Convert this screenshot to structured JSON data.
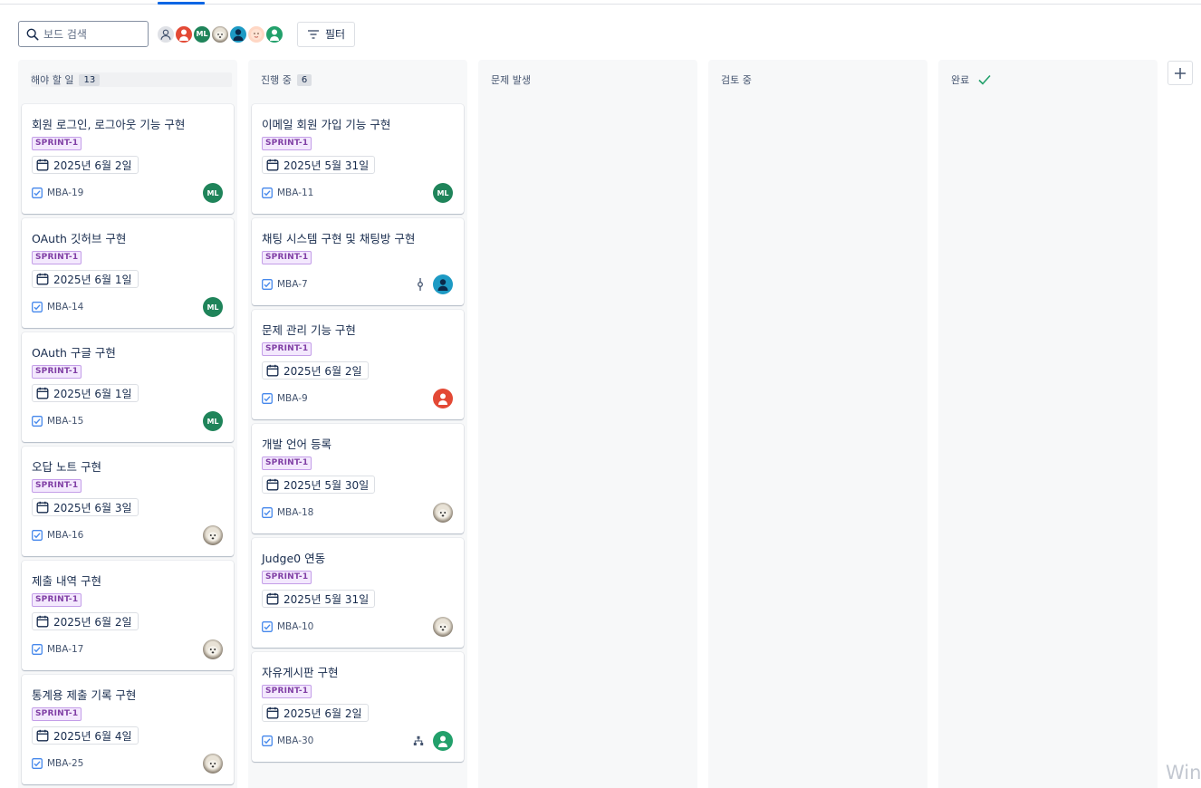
{
  "search": {
    "placeholder": "보드 검색"
  },
  "filter": {
    "label": "필터"
  },
  "avatar_initials": "ML",
  "columns": [
    {
      "title": "해야 할 일",
      "count": "13",
      "cards": [
        {
          "title": "회원 로그인, 로그아웃 기능 구현",
          "label": "SPRINT-1",
          "date": "2025년 6월 2일",
          "key": "MBA-19",
          "assignee": "ML"
        },
        {
          "title": "OAuth 깃허브 구현",
          "label": "SPRINT-1",
          "date": "2025년 6월 1일",
          "key": "MBA-14",
          "assignee": "ML"
        },
        {
          "title": "OAuth 구글 구현",
          "label": "SPRINT-1",
          "date": "2025년 6월 1일",
          "key": "MBA-15",
          "assignee": "ML"
        },
        {
          "title": "오답 노트 구현",
          "label": "SPRINT-1",
          "date": "2025년 6월 3일",
          "key": "MBA-16",
          "assignee": "dog"
        },
        {
          "title": "제출 내역 구현",
          "label": "SPRINT-1",
          "date": "2025년 6월 2일",
          "key": "MBA-17",
          "assignee": "dog"
        },
        {
          "title": "통계용 제출 기록 구현",
          "label": "SPRINT-1",
          "date": "2025년 6월 4일",
          "key": "MBA-25",
          "assignee": "dog"
        }
      ]
    },
    {
      "title": "진행 중",
      "count": "6",
      "cards": [
        {
          "title": "이메일 회원 가입 기능 구현",
          "label": "SPRINT-1",
          "date": "2025년 5월 31일",
          "key": "MBA-11",
          "assignee": "ML"
        },
        {
          "title": "채팅 시스템 구현 및 채팅방 구현",
          "label": "SPRINT-1",
          "date": "",
          "key": "MBA-7",
          "assignee": "teal",
          "extra_icon": "commit-icon"
        },
        {
          "title": "문제 관리 기능 구현",
          "label": "SPRINT-1",
          "date": "2025년 6월 2일",
          "key": "MBA-9",
          "assignee": "orange"
        },
        {
          "title": "개발 언어 등록",
          "label": "SPRINT-1",
          "date": "2025년 5월 30일",
          "key": "MBA-18",
          "assignee": "dog"
        },
        {
          "title": "Judge0 연동",
          "label": "SPRINT-1",
          "date": "2025년 5월 31일",
          "key": "MBA-10",
          "assignee": "dog"
        },
        {
          "title": "자유게시판 구현",
          "label": "SPRINT-1",
          "date": "2025년 6월 2일",
          "key": "MBA-30",
          "assignee": "green-user",
          "extra_icon": "subtask-icon"
        }
      ]
    },
    {
      "title": "문제 발생",
      "count": "",
      "cards": []
    },
    {
      "title": "검토 중",
      "count": "",
      "cards": []
    },
    {
      "title": "완료",
      "count": "",
      "cards": [],
      "done_icon": "check-icon"
    }
  ],
  "watermark": "Winc",
  "colors": {
    "accent": "#0c66e4",
    "label_purple": "#803fa5",
    "done_green": "#22a06b"
  }
}
